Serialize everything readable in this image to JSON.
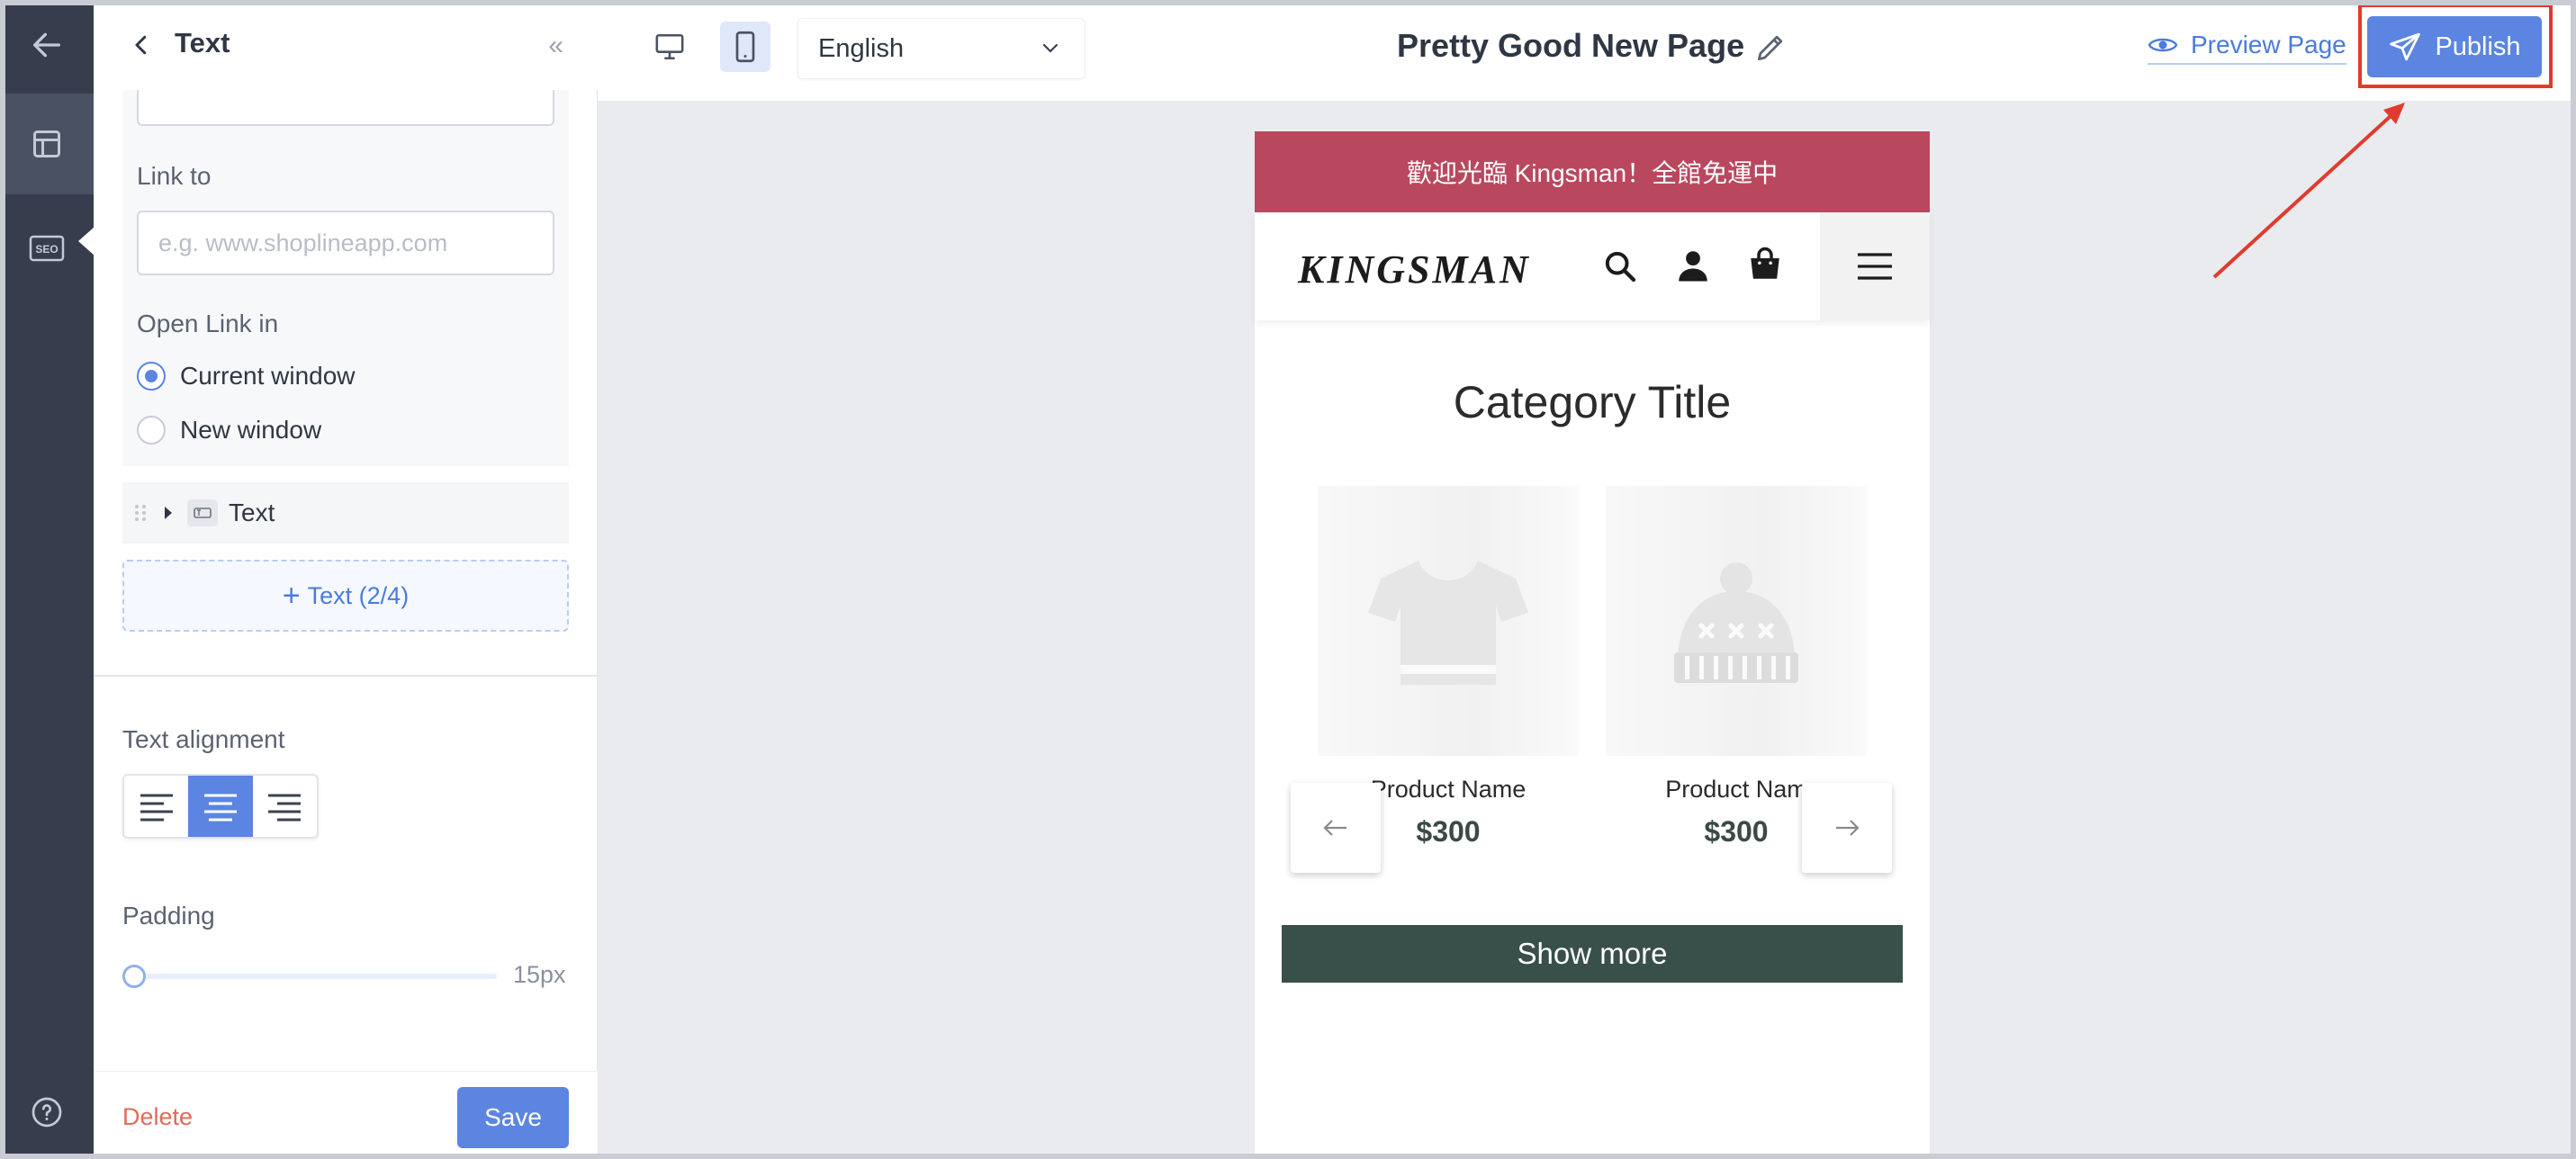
{
  "sidebar_rail": {
    "back_icon": "arrow-left-icon",
    "items": [
      {
        "name": "layout-icon",
        "active": true
      },
      {
        "name": "seo-icon",
        "label": "SEO",
        "active": false
      }
    ],
    "help_icon": "question-circle-icon"
  },
  "panel": {
    "title": "Text",
    "link_to_label": "Link to",
    "link_to_placeholder": "e.g. www.shoplineapp.com",
    "open_link_label": "Open Link in",
    "open_link_options": [
      {
        "label": "Current window",
        "checked": true
      },
      {
        "label": "New window",
        "checked": false
      }
    ],
    "text_item_label": "Text",
    "add_text_label": "Text (2/4)",
    "text_alignment_label": "Text alignment",
    "alignment_options": [
      "left",
      "center",
      "right"
    ],
    "alignment_selected": "center",
    "padding_label": "Padding",
    "padding_value": "15px",
    "padding_slider_fraction": 0.0,
    "delete_label": "Delete",
    "save_label": "Save"
  },
  "topbar": {
    "language": "English",
    "page_title": "Pretty Good New Page",
    "preview_label": "Preview Page",
    "publish_label": "Publish",
    "active_device": "mobile"
  },
  "preview": {
    "announcement": "歡迎光臨 Kingsman！全館免運中",
    "logo": "KINGSMAN",
    "category_title": "Category Title",
    "products": [
      {
        "name": "Product Name",
        "price": "$300",
        "image": "t-shirt"
      },
      {
        "name": "Product Nam",
        "price": "$300",
        "image": "beanie"
      }
    ],
    "show_more": "Show more"
  },
  "colors": {
    "accent": "#5b85e0",
    "announcement_bg": "#b9485f",
    "show_more_bg": "#394f4a",
    "annotation_red": "#e03b2e",
    "rail_bg": "#373d4d"
  }
}
